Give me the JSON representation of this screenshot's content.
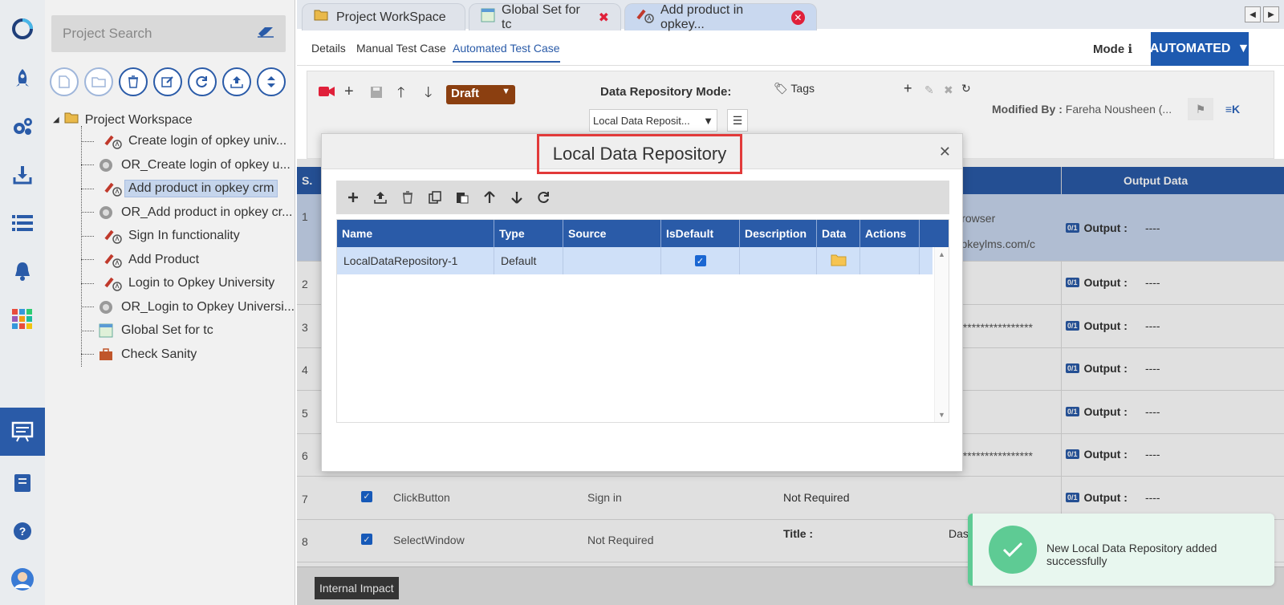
{
  "search": {
    "placeholder": "Project Search"
  },
  "tree": {
    "root": "Project Workspace",
    "nodes": [
      {
        "label": "Create login of opkey univ...",
        "icon": "testcase-icon"
      },
      {
        "label": "OR_Create login of opkey u...",
        "icon": "object-repository-icon"
      },
      {
        "label": "Add product in opkey crm",
        "icon": "testcase-icon"
      },
      {
        "label": "OR_Add product in opkey cr...",
        "icon": "object-repository-icon"
      },
      {
        "label": "Sign In functionality",
        "icon": "testcase-icon"
      },
      {
        "label": "Add Product",
        "icon": "testcase-icon"
      },
      {
        "label": "Login to Opkey University",
        "icon": "testcase-icon"
      },
      {
        "label": "OR_Login to Opkey Universi...",
        "icon": "object-repository-icon"
      },
      {
        "label": "Global Set for tc",
        "icon": "global-set-icon"
      },
      {
        "label": "Check Sanity",
        "icon": "suite-icon"
      }
    ]
  },
  "tabs": [
    {
      "label": "Project WorkSpace"
    },
    {
      "label": "Global Set for tc"
    },
    {
      "label": "Add product in opkey..."
    }
  ],
  "subtabs": [
    "Details",
    "Manual Test Case",
    "Automated Test Case"
  ],
  "mode": {
    "label": "Mode",
    "value": "AUTOMATED"
  },
  "toolbar": {
    "status": "Draft",
    "dr_mode_label": "Data Repository Mode:",
    "dr_mode_value": "Local Data Reposit...",
    "tags_label": "Tags",
    "modified_label": "Modified By :",
    "modified_value": "Fareha Nousheen (..."
  },
  "grid": {
    "header_sn": "S.",
    "header_output": "Output Data",
    "rows": [
      {
        "sn": "1",
        "partial": "lt Browser",
        "partial2": "://opkeylms.com/c"
      },
      {
        "sn": "2"
      },
      {
        "sn": "3",
        "partial": "********************"
      },
      {
        "sn": "4"
      },
      {
        "sn": "5",
        "partial": "n"
      },
      {
        "sn": "6",
        "partial": "********************"
      },
      {
        "sn": "7",
        "keyword": "ClickButton",
        "object": "Sign in",
        "data": "Not Required"
      },
      {
        "sn": "8",
        "keyword": "SelectWindow",
        "object": "Not Required",
        "data_label": "Title :",
        "data_value": "Dashb"
      }
    ],
    "output_label": "Output :",
    "output_value": "----",
    "output_badge": "0/1"
  },
  "bottom": {
    "internal_impact": "Internal Impact"
  },
  "modal": {
    "title": "Local Data Repository",
    "columns": [
      "Name",
      "Type",
      "Source",
      "IsDefault",
      "Description",
      "Data",
      "Actions"
    ],
    "rows": [
      {
        "name": "LocalDataRepository-1",
        "type": "Default",
        "source": "",
        "isdefault": true,
        "description": ""
      }
    ]
  },
  "toast": {
    "message": "New Local Data Repository added successfully"
  },
  "colors": {
    "accent": "#2a5ba8",
    "success": "#5ecb94",
    "draft": "#8b3f10",
    "highlight": "#e23a3a"
  }
}
